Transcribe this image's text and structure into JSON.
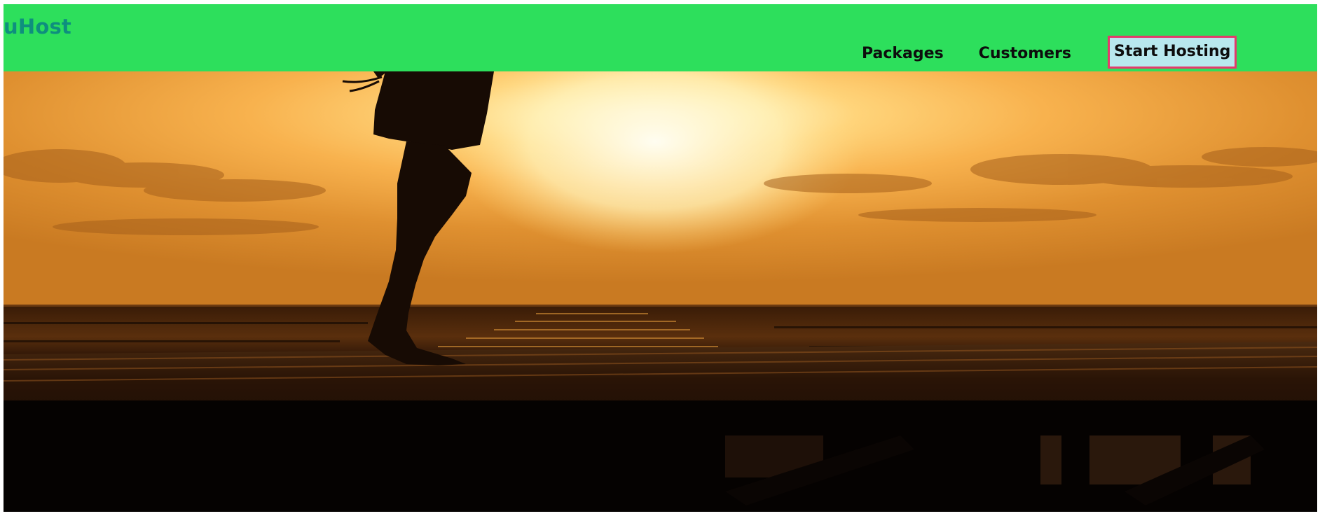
{
  "brand": {
    "name": "uHost",
    "color": "#0e8f7e"
  },
  "nav": {
    "items": [
      {
        "label": "Packages"
      },
      {
        "label": "Customers"
      },
      {
        "label": "Start Hosting"
      }
    ]
  },
  "colors": {
    "header_background": "#2ddf5c",
    "cta_background": "#b8e8ee",
    "cta_border": "#e33a6b",
    "nav_text": "#0d0d0d"
  },
  "hero": {
    "icon": "sunset-beach-photo-icon"
  }
}
